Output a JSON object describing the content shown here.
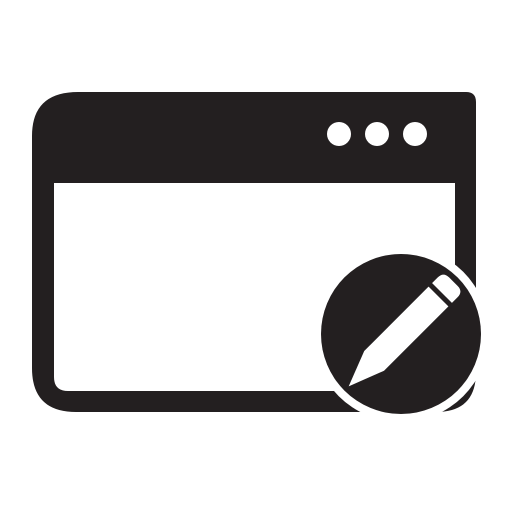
{
  "icon": {
    "name": "edit-window-icon",
    "parts": [
      "browser-window-icon",
      "three-dots-icon",
      "pencil-badge-icon"
    ],
    "colors": {
      "foreground": "#231f20",
      "background": "#ffffff"
    }
  }
}
